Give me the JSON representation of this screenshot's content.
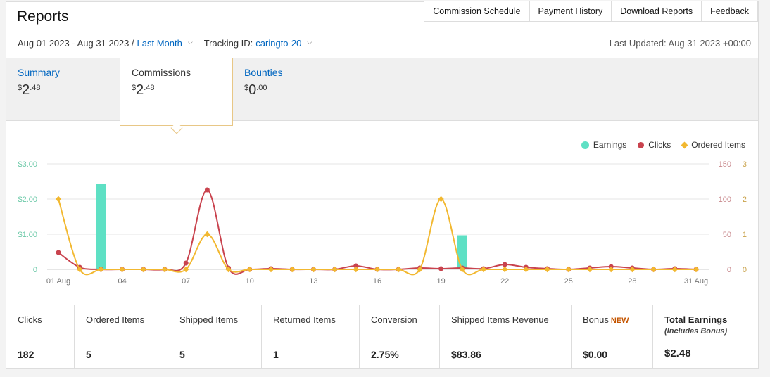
{
  "header": {
    "title": "Reports",
    "nav": [
      "Commission Schedule",
      "Payment History",
      "Download Reports",
      "Feedback"
    ]
  },
  "filters": {
    "date_range": "Aug 01 2023 - Aug 31 2023 /",
    "period": "Last Month",
    "tracking_label": "Tracking ID:",
    "tracking_id": "caringto-20",
    "last_updated": "Last Updated: Aug 31 2023 +00:00"
  },
  "summary_tabs": [
    {
      "label": "Summary",
      "dollar": "$",
      "whole": "2",
      "cents": ".48"
    },
    {
      "label": "Commissions",
      "dollar": "$",
      "whole": "2",
      "cents": ".48"
    },
    {
      "label": "Bounties",
      "dollar": "$",
      "whole": "0",
      "cents": ".00"
    }
  ],
  "legend": [
    "Earnings",
    "Clicks",
    "Ordered Items"
  ],
  "colors": {
    "earnings": "#5ee0c4",
    "clicks": "#c9434e",
    "ordered": "#f2b830",
    "link": "#0066c0",
    "new": "#c45500"
  },
  "chart_data": {
    "type": "bar+line",
    "x": [
      "01 Aug",
      "02",
      "03",
      "04",
      "05",
      "06",
      "07",
      "08",
      "09",
      "10",
      "11",
      "12",
      "13",
      "14",
      "15",
      "16",
      "17",
      "18",
      "19",
      "20",
      "21",
      "22",
      "23",
      "24",
      "25",
      "26",
      "27",
      "28",
      "29",
      "30",
      "31 Aug"
    ],
    "x_tick_labels": [
      "01 Aug",
      "04",
      "07",
      "10",
      "13",
      "16",
      "19",
      "22",
      "25",
      "28",
      "31 Aug"
    ],
    "y_left_ticks": [
      "0",
      "$1.00",
      "$2.00",
      "$3.00"
    ],
    "y_right1_ticks": [
      "0",
      "50",
      "100",
      "150"
    ],
    "y_right2_ticks": [
      "0",
      "1",
      "2",
      "3"
    ],
    "ylim_left": [
      0,
      3
    ],
    "ylim_right1": [
      0,
      150
    ],
    "ylim_right2": [
      0,
      3
    ],
    "series": [
      {
        "name": "Earnings",
        "axis": "left",
        "style": "bar",
        "values": [
          0,
          0,
          2.43,
          0,
          0,
          0,
          0,
          0,
          0,
          0,
          0,
          0,
          0,
          0,
          0,
          0,
          0,
          0,
          0,
          0.97,
          0,
          0,
          0,
          0,
          0,
          0,
          0,
          0,
          0,
          0,
          0
        ]
      },
      {
        "name": "Clicks",
        "axis": "right1",
        "style": "line",
        "values": [
          24,
          3,
          0,
          0,
          0,
          0,
          9,
          113,
          2,
          0,
          1,
          0,
          0,
          0,
          5,
          0,
          0,
          2,
          1,
          2,
          1,
          7,
          3,
          1,
          0,
          2,
          4,
          2,
          0,
          1,
          0
        ]
      },
      {
        "name": "Ordered Items",
        "axis": "right2",
        "style": "line",
        "values": [
          2,
          0,
          0,
          0,
          0,
          0,
          0,
          1,
          0,
          0,
          0,
          0,
          0,
          0,
          0,
          0,
          0,
          0,
          2,
          0,
          0,
          0,
          0,
          0,
          0,
          0,
          0,
          0,
          0,
          0,
          0
        ]
      }
    ],
    "grid": true,
    "legend_position": "top-right"
  },
  "stats": [
    {
      "label": "Clicks",
      "value": "182"
    },
    {
      "label": "Ordered Items",
      "value": "5"
    },
    {
      "label": "Shipped Items",
      "value": "5"
    },
    {
      "label": "Returned Items",
      "value": "1"
    },
    {
      "label": "Conversion",
      "value": "2.75%"
    },
    {
      "label": "Shipped Items Revenue",
      "value": "$83.86"
    },
    {
      "label": "Bonus",
      "badge": "NEW",
      "value": "$0.00"
    },
    {
      "label": "Total Earnings",
      "sublabel": "(Includes Bonus)",
      "value": "$2.48"
    }
  ]
}
